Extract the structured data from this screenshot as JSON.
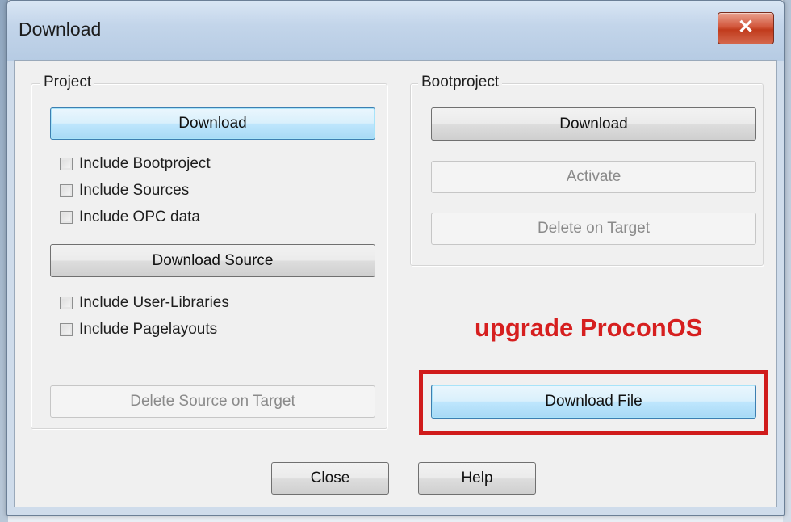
{
  "window": {
    "title": "Download",
    "close_glyph": "✕"
  },
  "project": {
    "label": "Project",
    "download_label": "Download",
    "checkboxes": [
      {
        "label": "Include Bootproject",
        "checked": false
      },
      {
        "label": "Include Sources",
        "checked": false
      },
      {
        "label": "Include OPC data",
        "checked": false
      }
    ],
    "download_source_label": "Download Source",
    "source_checkboxes": [
      {
        "label": "Include User-Libraries",
        "checked": false
      },
      {
        "label": "Include Pagelayouts",
        "checked": false
      }
    ],
    "delete_source_label": "Delete Source on Target"
  },
  "bootproject": {
    "label": "Bootproject",
    "download_label": "Download",
    "activate_label": "Activate",
    "delete_label": "Delete on Target"
  },
  "annotation": {
    "text": "upgrade ProconOS",
    "color": "#d61f1f"
  },
  "download_file_label": "Download File",
  "footer": {
    "close_label": "Close",
    "help_label": "Help"
  }
}
